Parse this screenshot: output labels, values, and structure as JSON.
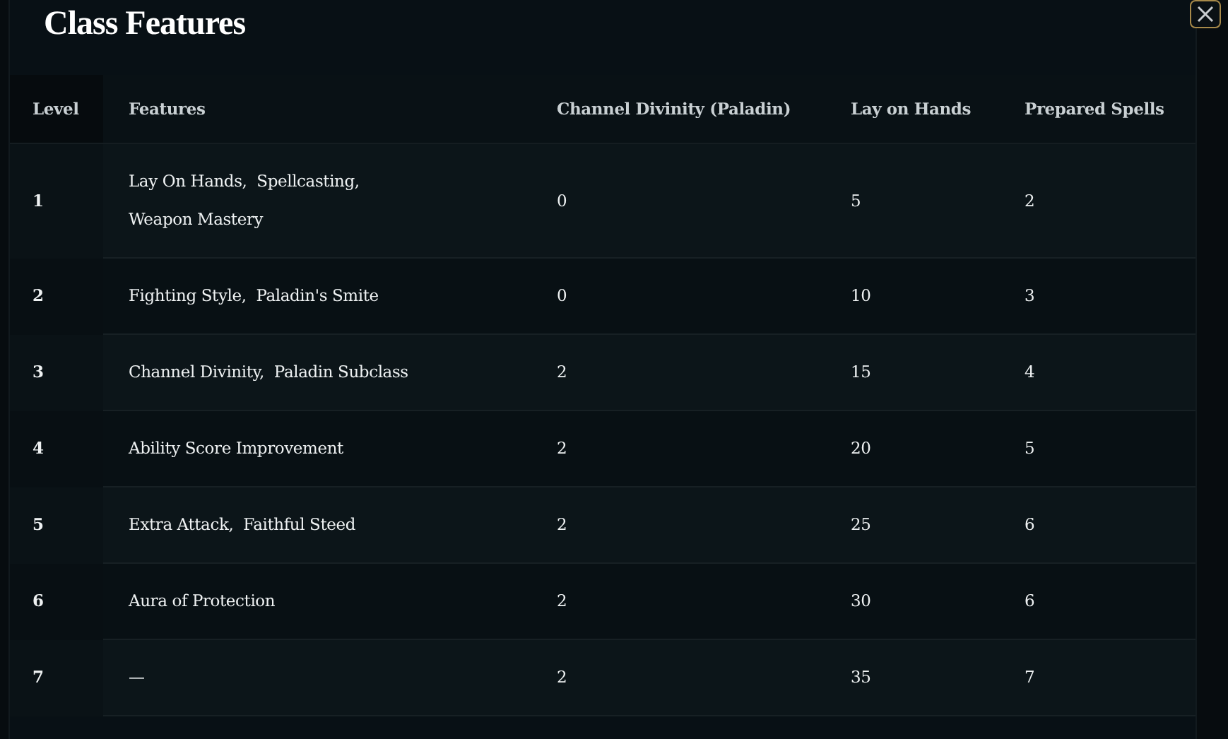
{
  "title": "Class Features",
  "table": {
    "columns": [
      "Level",
      "Features",
      "Channel Divinity (Paladin)",
      "Lay on Hands",
      "Prepared Spells"
    ],
    "rows": [
      {
        "level": "1",
        "features": "Lay On Hands,  Spellcasting,  Weapon Mastery",
        "channel_divinity": "0",
        "lay_on_hands": "5",
        "prepared_spells": "2"
      },
      {
        "level": "2",
        "features": "Fighting Style,  Paladin's Smite",
        "channel_divinity": "0",
        "lay_on_hands": "10",
        "prepared_spells": "3"
      },
      {
        "level": "3",
        "features": "Channel Divinity,  Paladin Subclass",
        "channel_divinity": "2",
        "lay_on_hands": "15",
        "prepared_spells": "4"
      },
      {
        "level": "4",
        "features": "Ability Score Improvement",
        "channel_divinity": "2",
        "lay_on_hands": "20",
        "prepared_spells": "5"
      },
      {
        "level": "5",
        "features": "Extra Attack,  Faithful Steed",
        "channel_divinity": "2",
        "lay_on_hands": "25",
        "prepared_spells": "6"
      },
      {
        "level": "6",
        "features": "Aura of Protection",
        "channel_divinity": "2",
        "lay_on_hands": "30",
        "prepared_spells": "6"
      },
      {
        "level": "7",
        "features": "—",
        "channel_divinity": "2",
        "lay_on_hands": "35",
        "prepared_spells": "7"
      }
    ]
  }
}
